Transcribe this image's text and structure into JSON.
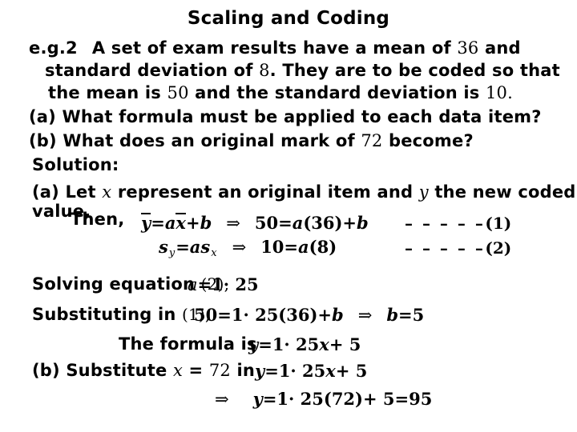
{
  "slide": {
    "title": "Scaling and Coding",
    "background_color": "#ffffff",
    "text_color": "#000000"
  },
  "problem": {
    "label": "e.g.2",
    "line1_a": "A set of exam results have a mean of",
    "line1_mean": "36",
    "line1_b": "and",
    "line2_a": "standard deviation of",
    "line2_sd": "8",
    "line2_b": ".  They are to be coded so that",
    "line3_a": "the mean is",
    "line3_mean": "50",
    "line3_b": "and the standard deviation is",
    "line3_sd": "10",
    "line3_c": ".",
    "part_a": "(a) What formula must be applied to each data item?",
    "part_b_a": "(b) What does an original mark of",
    "part_b_mark": "72",
    "part_b_b": "become?"
  },
  "solution": {
    "heading": "Solution:",
    "part_a_text_1": "(a) Let",
    "part_a_var_x": "x",
    "part_a_text_2": "represent an original item and",
    "part_a_var_y": "y",
    "part_a_text_3": "the new coded",
    "part_a_text_4": "value.",
    "then_label": "Then,"
  },
  "equations": {
    "eq1": {
      "lhs_y": "y",
      "eq_sign": "=",
      "a": "a",
      "x": "x",
      "plus": "+",
      "b": "b",
      "implies": "⇒",
      "rhs": "50 = a(36) + b",
      "rhs_num1": "50",
      "rhs_eq": "=",
      "rhs_a": "a",
      "rhs_paren": "(36)",
      "rhs_plus": "+",
      "rhs_b": "b",
      "dashes": "– – – – –",
      "number": "(1)"
    },
    "eq2": {
      "lhs_s": "s",
      "lhs_sub": "y",
      "eq_sign": "=",
      "a": "a",
      "rhs_s": "s",
      "rhs_sub": "x",
      "implies": "⇒",
      "rhs_num1": "10",
      "rhs_eq": "=",
      "rhs_a": "a",
      "rhs_paren": "(8)",
      "dashes": "– – – – –",
      "number": "(2)"
    }
  },
  "working": {
    "solving_label": "Solving equation",
    "solving_ref": "(2),",
    "solving_a": "a",
    "solving_eq": "=",
    "solving_val": "1· 25",
    "subst_label": "Substituting in",
    "subst_ref": "(1),",
    "subst_lhs": "50",
    "subst_eq": "=",
    "subst_val": "1· 25(36)",
    "subst_plus": "+",
    "subst_b": "b",
    "subst_implies": "⇒",
    "subst_b2": "b",
    "subst_eq2": "=",
    "subst_b_val": "5",
    "formula_label": "The formula is",
    "formula_y": "y",
    "formula_eq": "=",
    "formula_rhs": "1· 25",
    "formula_x": "x",
    "formula_plus": "+ 5"
  },
  "part_b_solution": {
    "label": "(b) Substitute",
    "var_x": "x",
    "eq": "=",
    "value": "72",
    "in_word": "in",
    "formula_y": "y",
    "formula_eq": "=",
    "formula_rhs": "1· 25",
    "formula_x": "x",
    "formula_plus": "+ 5",
    "final_implies": "⇒",
    "final_y": "y",
    "final_eq": "=",
    "final_expr": "1· 25(72)",
    "final_plus": "+ 5",
    "final_eq2": "=",
    "final_answer": "95"
  }
}
